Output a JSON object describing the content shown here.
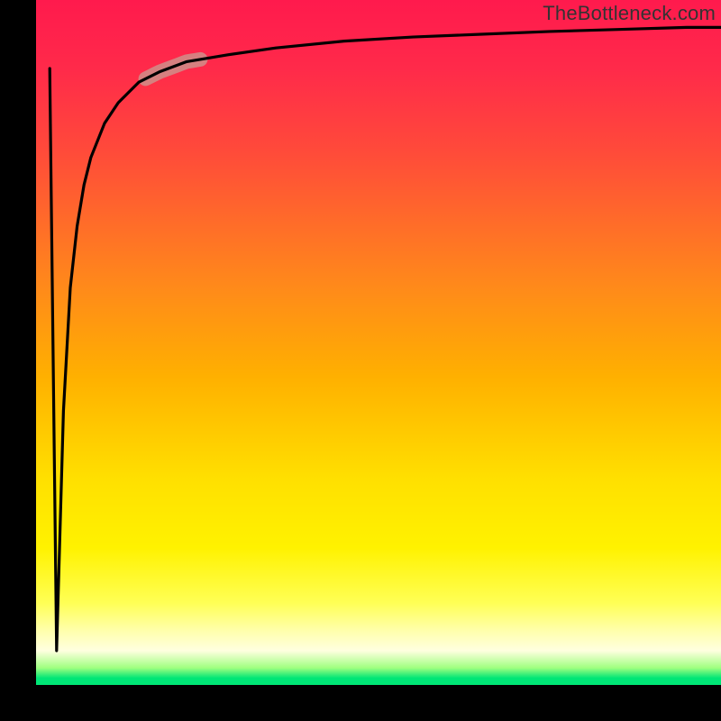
{
  "watermark": "TheBottleneck.com",
  "colors": {
    "frame": "#000000",
    "gradient_top": "#ff1a4d",
    "gradient_mid": "#ffe000",
    "gradient_bottom": "#00e676",
    "curve": "#000000",
    "highlight": "#cf8f8a"
  },
  "chart_data": {
    "type": "line",
    "title": "",
    "xlabel": "",
    "ylabel": "",
    "xlim": [
      0,
      100
    ],
    "ylim": [
      0,
      100
    ],
    "grid": false,
    "legend": false,
    "annotations": [
      "TheBottleneck.com"
    ],
    "series": [
      {
        "name": "curve",
        "x": [
          2,
          3,
          4,
          5,
          6,
          7,
          8,
          10,
          12,
          15,
          18,
          22,
          28,
          35,
          45,
          55,
          65,
          75,
          85,
          95,
          100
        ],
        "y": [
          90,
          5,
          40,
          58,
          67,
          73,
          77,
          82,
          85,
          88,
          89.5,
          91,
          92,
          93,
          94,
          94.6,
          95,
          95.4,
          95.7,
          96,
          96
        ]
      }
    ],
    "highlight_segment": {
      "series": "curve",
      "x_range": [
        16,
        24
      ],
      "note": "thick rounded beige overlay on curve"
    }
  }
}
